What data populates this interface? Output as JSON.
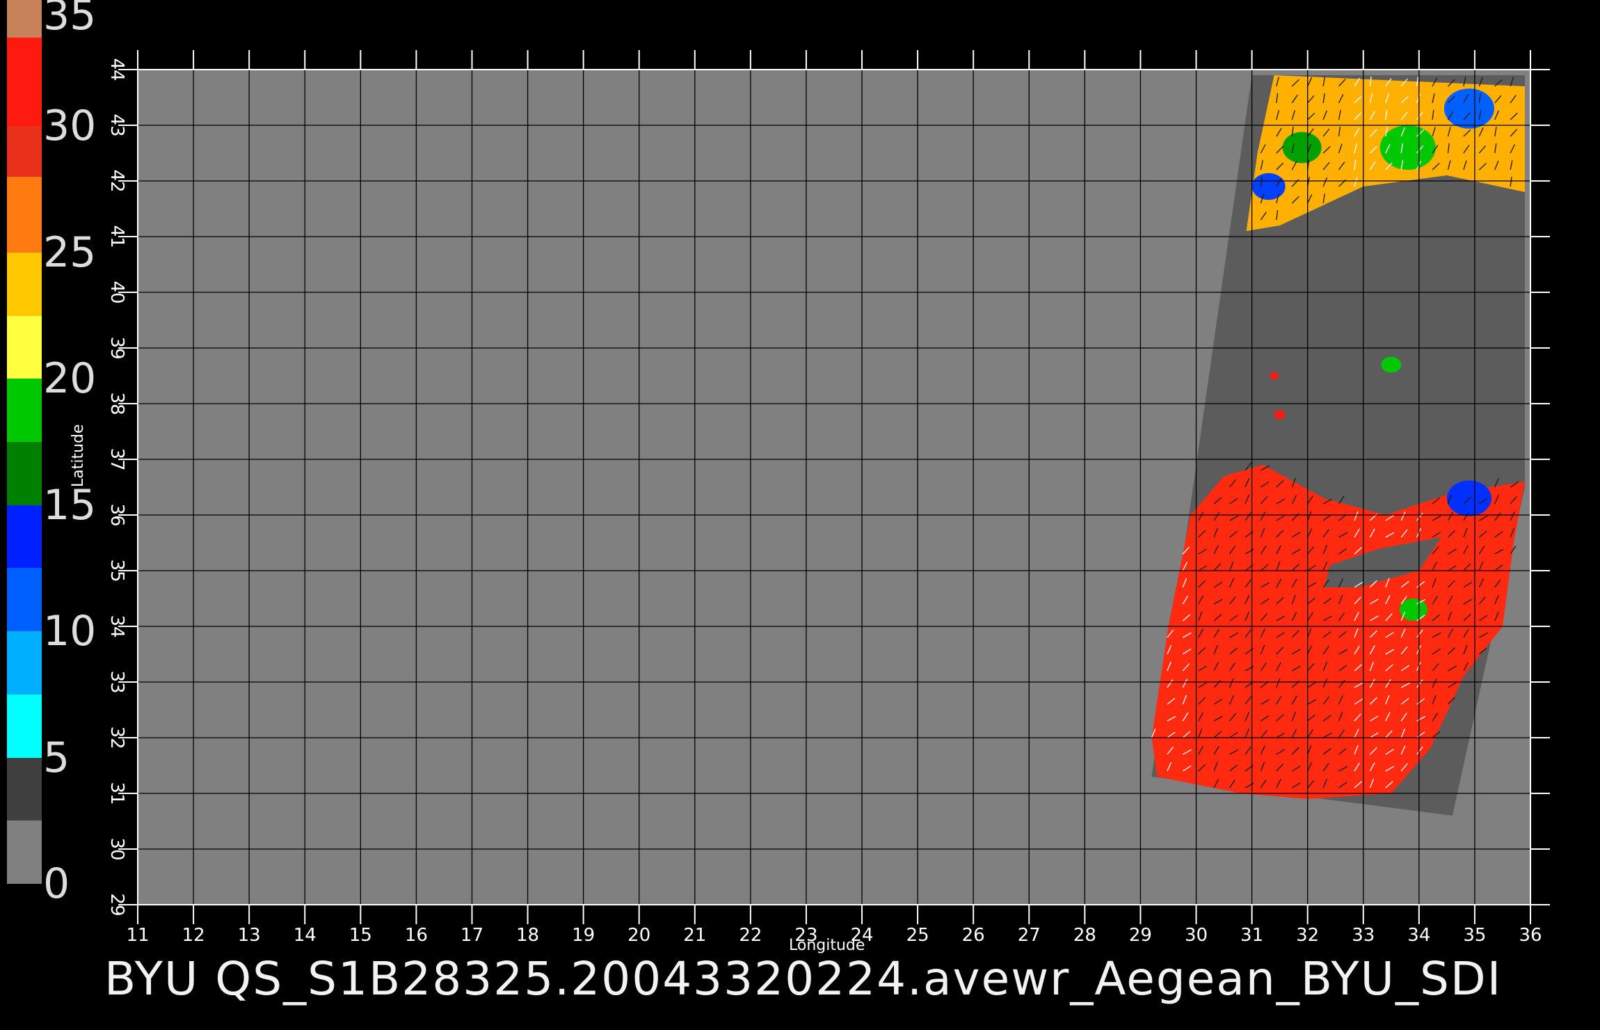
{
  "title": "BYU  QS_S1B28325.20043320224.avewr_Aegean_BYU_SDI",
  "colors": {
    "background": "#000000",
    "land": "#808080",
    "swath": "#5c5c5c",
    "grid": "#000000",
    "axis": "#ffffff"
  },
  "colorbar": {
    "labels": [
      "35",
      "30",
      "25",
      "20",
      "15",
      "10",
      "5",
      "0"
    ],
    "min": 0,
    "max": 35,
    "segments": [
      {
        "from": 33.5,
        "to": 35,
        "color": "#c8825a"
      },
      {
        "from": 30,
        "to": 33.5,
        "color": "#ff1a10"
      },
      {
        "from": 28,
        "to": 30,
        "color": "#e8301a"
      },
      {
        "from": 25,
        "to": 28,
        "color": "#ff7a10"
      },
      {
        "from": 22.5,
        "to": 25,
        "color": "#ffc800"
      },
      {
        "from": 20,
        "to": 22.5,
        "color": "#ffff40"
      },
      {
        "from": 17.5,
        "to": 20,
        "color": "#00c800"
      },
      {
        "from": 15,
        "to": 17.5,
        "color": "#008000"
      },
      {
        "from": 12.5,
        "to": 15,
        "color": "#0020ff"
      },
      {
        "from": 10,
        "to": 12.5,
        "color": "#0060ff"
      },
      {
        "from": 7.5,
        "to": 10,
        "color": "#00b0ff"
      },
      {
        "from": 5,
        "to": 7.5,
        "color": "#00ffff"
      },
      {
        "from": 2.5,
        "to": 5,
        "color": "#404040"
      },
      {
        "from": 0,
        "to": 2.5,
        "color": "#808080"
      }
    ]
  },
  "map": {
    "lon_range": [
      11,
      36
    ],
    "lat_range": [
      29,
      44
    ],
    "x_axis_label": "Longitude",
    "y_axis_label": "Latitude",
    "lon_ticks": [
      "11",
      "12",
      "13",
      "14",
      "15",
      "16",
      "17",
      "18",
      "19",
      "20",
      "21",
      "22",
      "23",
      "24",
      "25",
      "26",
      "27",
      "28",
      "29",
      "30",
      "31",
      "32",
      "33",
      "34",
      "35",
      "36"
    ],
    "lat_ticks": [
      "29",
      "30",
      "31",
      "32",
      "33",
      "34",
      "35",
      "36",
      "37",
      "38",
      "39",
      "40",
      "41",
      "42",
      "43",
      "44"
    ],
    "swath_corners_lonlat": [
      [
        31.0,
        43.9
      ],
      [
        35.9,
        43.9
      ],
      [
        35.9,
        36.5
      ],
      [
        34.6,
        30.6
      ],
      [
        29.2,
        31.3
      ],
      [
        31.0,
        43.9
      ]
    ],
    "north_field_lonlat": [
      [
        31.4,
        43.9
      ],
      [
        35.9,
        43.7
      ],
      [
        35.9,
        41.8
      ],
      [
        34.5,
        42.1
      ],
      [
        33.0,
        41.9
      ],
      [
        31.5,
        41.2
      ],
      [
        30.9,
        41.1
      ],
      [
        31.1,
        42.5
      ]
    ],
    "south_field_lonlat": [
      [
        29.3,
        31.3
      ],
      [
        30.8,
        31.0
      ],
      [
        32.0,
        30.9
      ],
      [
        33.5,
        31.0
      ],
      [
        34.2,
        31.8
      ],
      [
        34.8,
        33.1
      ],
      [
        35.5,
        34.0
      ],
      [
        35.7,
        35.5
      ],
      [
        35.9,
        36.6
      ],
      [
        34.6,
        36.4
      ],
      [
        33.4,
        36.0
      ],
      [
        32.3,
        36.3
      ],
      [
        31.2,
        36.9
      ],
      [
        30.5,
        36.7
      ],
      [
        29.9,
        36.0
      ],
      [
        29.5,
        34.0
      ],
      [
        29.2,
        32.0
      ]
    ],
    "cyprus_lonlat": [
      [
        32.4,
        35.1
      ],
      [
        33.3,
        35.4
      ],
      [
        34.4,
        35.6
      ],
      [
        34.0,
        35.0
      ],
      [
        32.9,
        34.7
      ],
      [
        32.3,
        34.7
      ]
    ],
    "patches": [
      {
        "lon": 34.9,
        "lat": 43.3,
        "r": 0.45,
        "color": "#0060ff"
      },
      {
        "lon": 31.9,
        "lat": 42.6,
        "r": 0.35,
        "color": "#00a000"
      },
      {
        "lon": 33.8,
        "lat": 42.6,
        "r": 0.5,
        "color": "#00c800"
      },
      {
        "lon": 31.3,
        "lat": 41.9,
        "r": 0.3,
        "color": "#0040ff"
      },
      {
        "lon": 34.9,
        "lat": 36.3,
        "r": 0.4,
        "color": "#0030ff"
      },
      {
        "lon": 33.9,
        "lat": 34.3,
        "r": 0.25,
        "color": "#00c800"
      },
      {
        "lon": 33.5,
        "lat": 38.7,
        "r": 0.18,
        "color": "#00c800"
      },
      {
        "lon": 31.4,
        "lat": 38.5,
        "r": 0.08,
        "color": "#ff1a10"
      },
      {
        "lon": 31.5,
        "lat": 37.8,
        "r": 0.1,
        "color": "#ff1a10"
      }
    ]
  }
}
